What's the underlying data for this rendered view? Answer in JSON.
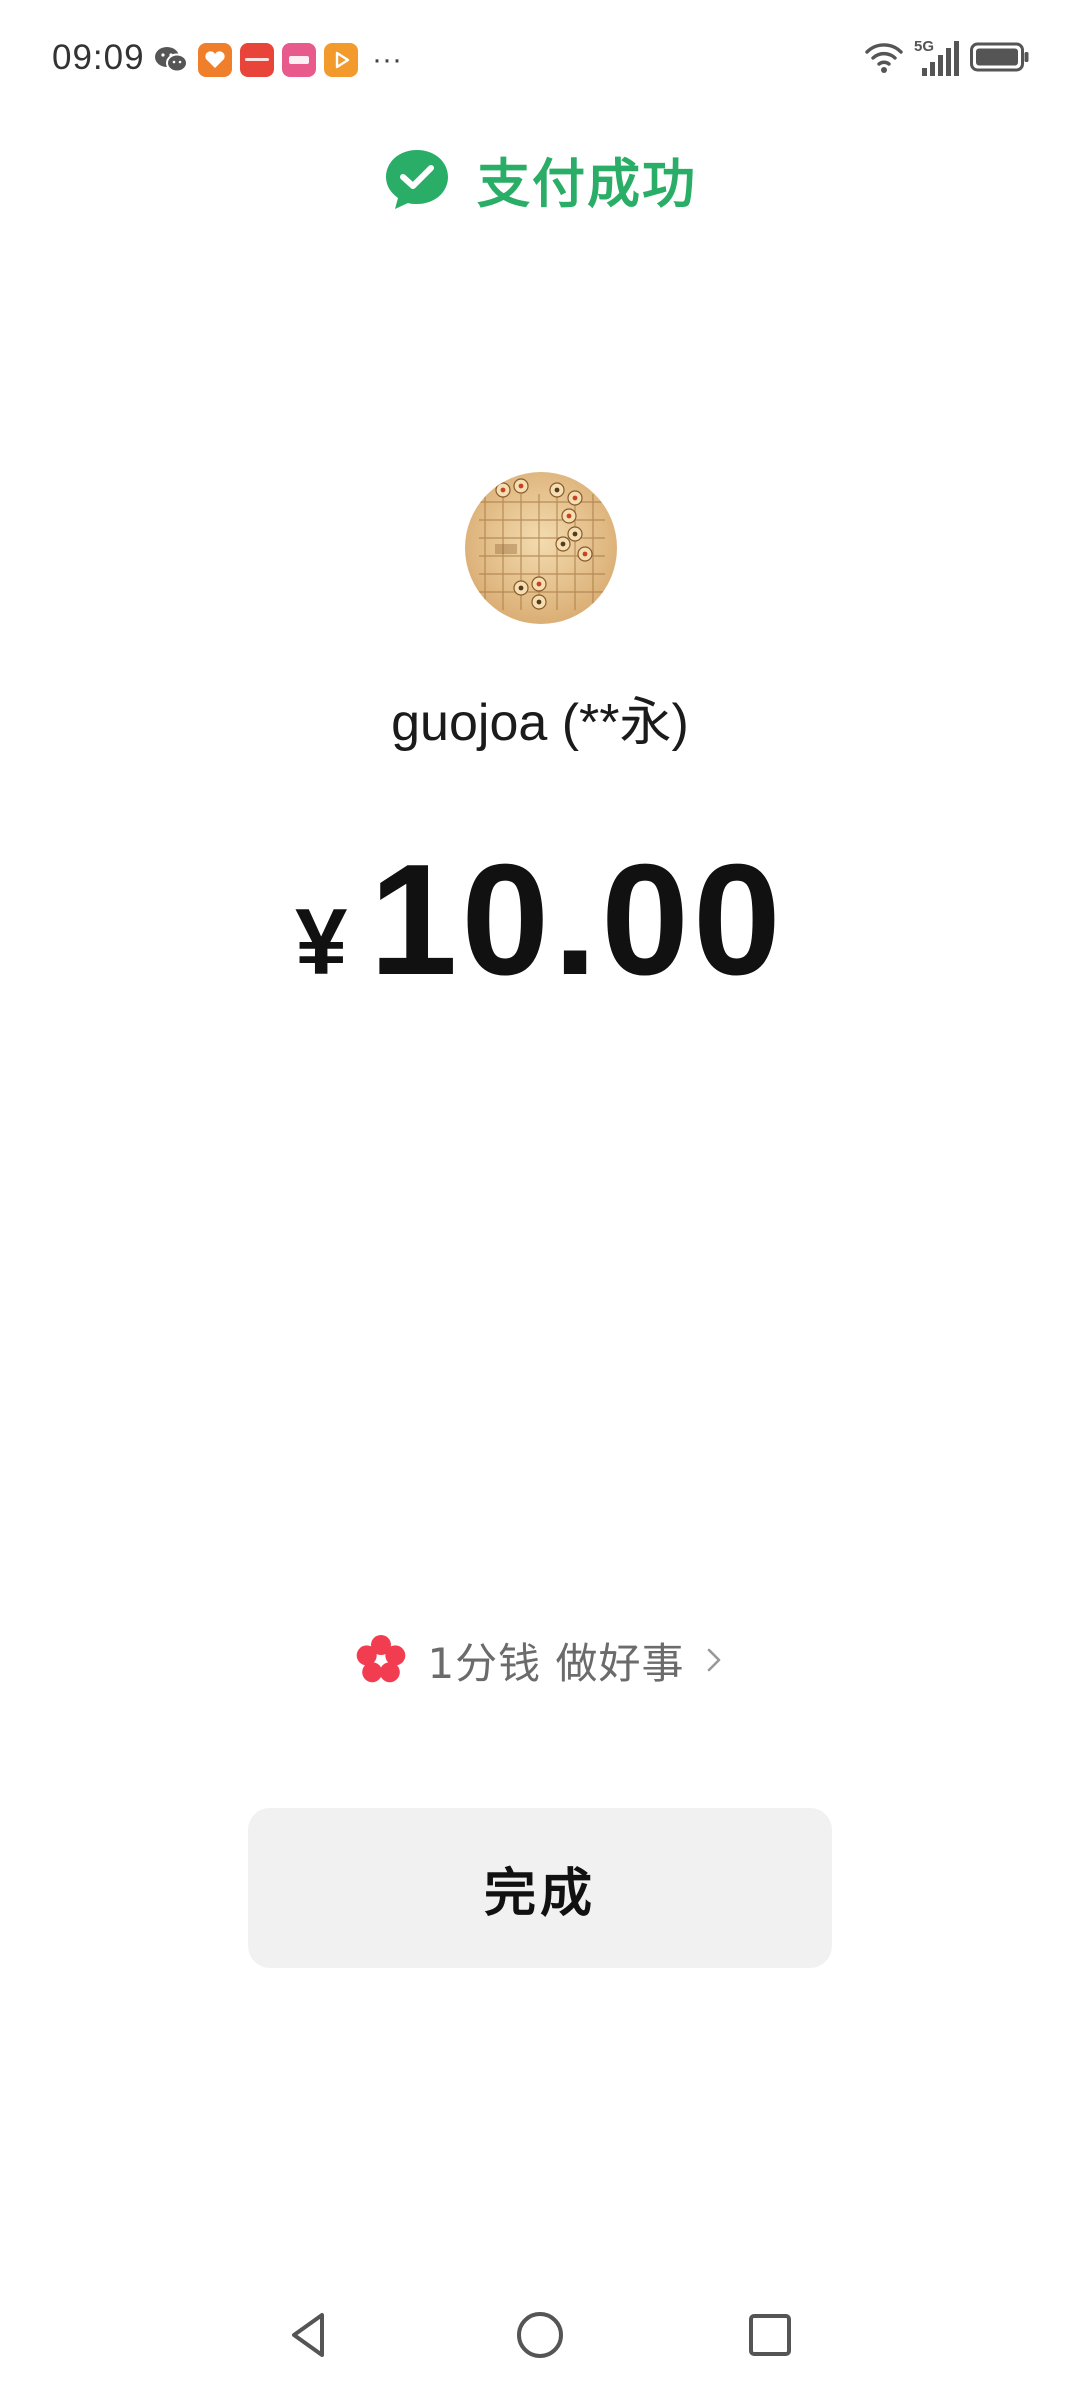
{
  "status_bar": {
    "time": "09:09",
    "notification_icons": [
      {
        "name": "wechat-icon",
        "color": "#555555"
      },
      {
        "name": "taobao-app-icon",
        "color": "#f07f2b"
      },
      {
        "name": "huawei-app-icon",
        "color": "#e8443a"
      },
      {
        "name": "lofter-app-icon",
        "color": "#e85a8c"
      },
      {
        "name": "video-app-icon",
        "color": "#f29b2c"
      }
    ],
    "more_indicator": "···",
    "network_type": "5G",
    "system_icons": [
      "wifi-icon",
      "cellular-signal-icon",
      "battery-icon"
    ]
  },
  "header": {
    "title": "支付成功",
    "accent_color": "#2aae67",
    "icon": "check-circle-icon"
  },
  "payee": {
    "avatar": "chess-board-avatar",
    "name": "guojoa (**永)"
  },
  "payment": {
    "currency_symbol": "¥",
    "amount": "10.00"
  },
  "charity": {
    "icon": "flower-icon",
    "label": "1分钱 做好事",
    "icon_color": "#f23c4f"
  },
  "actions": {
    "done_label": "完成"
  },
  "navigation": {
    "buttons": [
      "back",
      "home",
      "recent-apps"
    ]
  }
}
